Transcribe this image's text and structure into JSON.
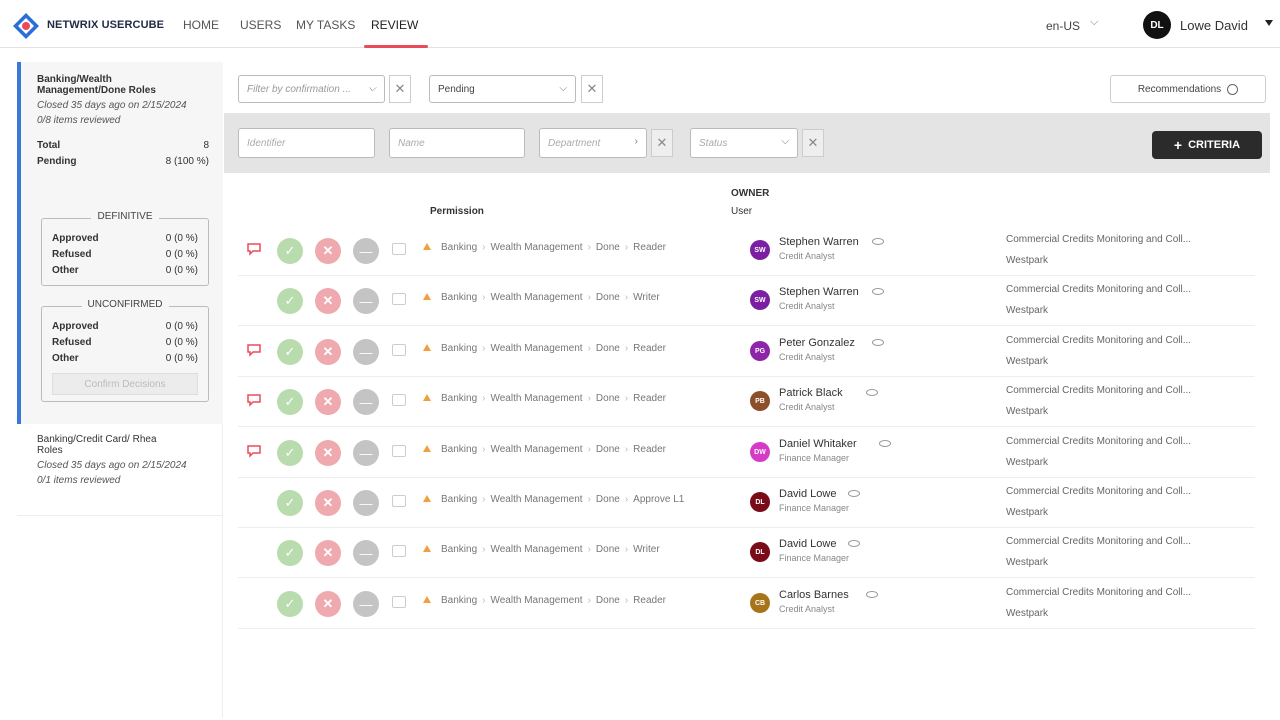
{
  "app": {
    "brand": "NETWRIX USERCUBE"
  },
  "nav": {
    "items": [
      {
        "label": "HOME"
      },
      {
        "label": "USERS"
      },
      {
        "label": "MY TASKS"
      },
      {
        "label": "REVIEW"
      }
    ],
    "active": "REVIEW"
  },
  "header": {
    "language": "en-US",
    "user_initials": "DL",
    "user_name": "Lowe David"
  },
  "sidebar": {
    "campaigns": [
      {
        "title": "Banking/Wealth Management/Done Roles",
        "closed": "Closed 35 days ago on 2/15/2024",
        "reviewed": "0/8 items reviewed",
        "total_label": "Total",
        "total_value": "8",
        "pending_label": "Pending",
        "pending_value": "8 (100 %)",
        "definitive": {
          "title": "DEFINITIVE",
          "approved_label": "Approved",
          "approved": "0 (0 %)",
          "refused_label": "Refused",
          "refused": "0 (0 %)",
          "other_label": "Other",
          "other": "0 (0 %)"
        },
        "unconfirmed": {
          "title": "UNCONFIRMED",
          "approved_label": "Approved",
          "approved": "0 (0 %)",
          "refused_label": "Refused",
          "refused": "0 (0 %)",
          "other_label": "Other",
          "other": "0 (0 %)"
        },
        "confirm_label": "Confirm Decisions"
      },
      {
        "title": "Banking/Credit Card/ Rhea Roles",
        "closed": "Closed 35 days ago on 2/15/2024",
        "reviewed": "0/1 items reviewed"
      }
    ]
  },
  "filters": {
    "confirmation_placeholder": "Filter by confirmation ...",
    "status_value": "Pending",
    "recommendations_label": "Recommendations",
    "identifier_placeholder": "Identifier",
    "name_placeholder": "Name",
    "department_placeholder": "Department",
    "status_placeholder": "Status",
    "criteria_label": "CRITERIA"
  },
  "table": {
    "permission_header": "Permission",
    "owner_header": "OWNER",
    "user_header": "User",
    "rows": [
      {
        "path": [
          "Banking",
          "Wealth Management",
          "Done",
          "Reader"
        ],
        "initials": "SW",
        "avatar_color": "#7b1fa2",
        "name": "Stephen Warren",
        "role": "Credit Analyst",
        "org": "Commercial Credits Monitoring and Coll...",
        "site": "Westpark",
        "comment": true
      },
      {
        "path": [
          "Banking",
          "Wealth Management",
          "Done",
          "Writer"
        ],
        "initials": "SW",
        "avatar_color": "#7b1fa2",
        "name": "Stephen Warren",
        "role": "Credit Analyst",
        "org": "Commercial Credits Monitoring and Coll...",
        "site": "Westpark",
        "comment": false
      },
      {
        "path": [
          "Banking",
          "Wealth Management",
          "Done",
          "Reader"
        ],
        "initials": "PG",
        "avatar_color": "#8e24aa",
        "name": "Peter Gonzalez",
        "role": "Credit Analyst",
        "org": "Commercial Credits Monitoring and Coll...",
        "site": "Westpark",
        "comment": true
      },
      {
        "path": [
          "Banking",
          "Wealth Management",
          "Done",
          "Reader"
        ],
        "initials": "PB",
        "avatar_color": "#8d4e2a",
        "name": "Patrick Black",
        "role": "Credit Analyst",
        "org": "Commercial Credits Monitoring and Coll...",
        "site": "Westpark",
        "comment": true
      },
      {
        "path": [
          "Banking",
          "Wealth Management",
          "Done",
          "Reader"
        ],
        "initials": "DW",
        "avatar_color": "#d63bc8",
        "name": "Daniel Whitaker",
        "role": "Finance Manager",
        "org": "Commercial Credits Monitoring and Coll...",
        "site": "Westpark",
        "comment": true
      },
      {
        "path": [
          "Banking",
          "Wealth Management",
          "Done",
          "Approve L1"
        ],
        "initials": "DL",
        "avatar_color": "#7a0c1a",
        "name": "David Lowe",
        "role": "Finance Manager",
        "org": "Commercial Credits Monitoring and Coll...",
        "site": "Westpark",
        "comment": false
      },
      {
        "path": [
          "Banking",
          "Wealth Management",
          "Done",
          "Writer"
        ],
        "initials": "DL",
        "avatar_color": "#7a0c1a",
        "name": "David Lowe",
        "role": "Finance Manager",
        "org": "Commercial Credits Monitoring and Coll...",
        "site": "Westpark",
        "comment": false
      },
      {
        "path": [
          "Banking",
          "Wealth Management",
          "Done",
          "Reader"
        ],
        "initials": "CB",
        "avatar_color": "#a8741a",
        "name": "Carlos Barnes",
        "role": "Credit Analyst",
        "org": "Commercial Credits Monitoring and Coll...",
        "site": "Westpark",
        "comment": false
      }
    ]
  },
  "icons": {
    "comment": "speech-bubble-icon",
    "approve": "check-icon",
    "refuse": "close-icon",
    "other": "dash-icon",
    "note": "note-icon",
    "warning": "warning-icon",
    "visibility": "eye-icon"
  },
  "colors": {
    "accent": "#e94b5a",
    "selected_border": "#3a78d8",
    "approve": "#b9dcae",
    "refuse": "#eeaaae",
    "other": "#c4c4c4",
    "criteria_button": "#2b2b2b"
  }
}
